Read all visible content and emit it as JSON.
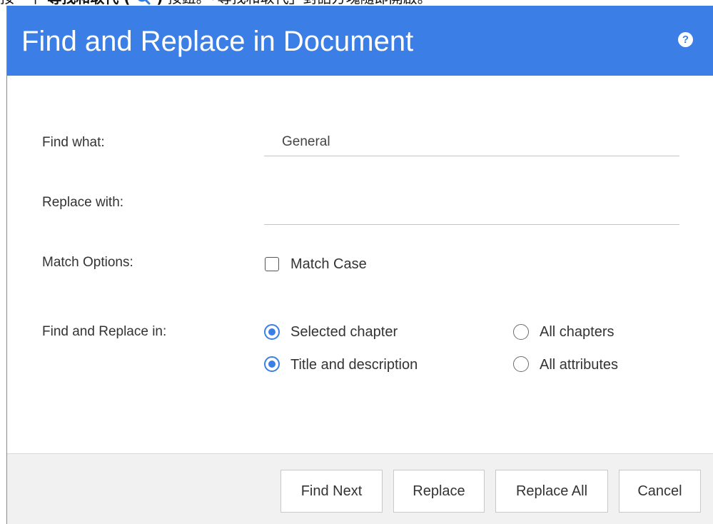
{
  "context": {
    "prefix": "按一下",
    "bold": "尋找和取代 (",
    "bold_close": ")",
    "suffix": "按鈕。「尋找和取代」對話方塊隨即開啟。",
    "icon": "magnifier-icon"
  },
  "dialog": {
    "title": "Find and Replace in Document",
    "help_glyph": "?",
    "help_icon": "help-icon",
    "header_color": "#3b7fe6"
  },
  "form": {
    "find_label": "Find what:",
    "find_value": "General",
    "replace_label": "Replace with:",
    "replace_value": "",
    "match_label": "Match Options:",
    "match_case_label": "Match Case",
    "match_case_checked": false,
    "scope_label": "Find and Replace in:",
    "scope_options": {
      "selected_chapter": {
        "label": "Selected chapter",
        "checked": true
      },
      "all_chapters": {
        "label": "All chapters",
        "checked": false
      },
      "title_description": {
        "label": "Title and description",
        "checked": true
      },
      "all_attributes": {
        "label": "All attributes",
        "checked": false
      }
    }
  },
  "buttons": {
    "find_next": "Find Next",
    "replace": "Replace",
    "replace_all": "Replace All",
    "cancel": "Cancel"
  }
}
